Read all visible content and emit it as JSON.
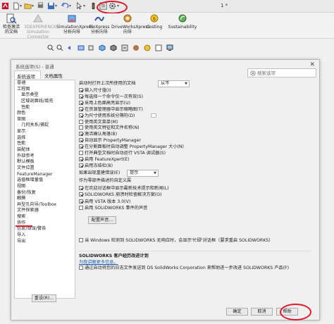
{
  "window": {
    "title": "1 *"
  },
  "toolbar_colors": {
    "accent": "#e0162b",
    "link": "#1a5fb4"
  },
  "ribbon": {
    "items": [
      {
        "label_1": "检查激活",
        "label_2": "的文档",
        "icon": "magnifier-doc-icon"
      },
      {
        "label_1": "3DEXPERIENCE",
        "label_2": "Simulation",
        "label_3": "Connector",
        "icon": "3dx-icon"
      },
      {
        "label_1": "SimulationXpress",
        "label_2": "分析向导",
        "icon": "simulation-icon"
      },
      {
        "label_1": "FloXpress",
        "label_2": "分析向导",
        "icon": "floxpress-icon"
      },
      {
        "label_1": "DriveWorksXpress",
        "label_2": "向导",
        "icon": "driveworks-icon"
      },
      {
        "label_1": "Costing",
        "icon": "costing-icon"
      },
      {
        "label_1": "Sustainability",
        "icon": "sustainability-icon"
      }
    ]
  },
  "dialog": {
    "title": "系统选项(S) - 普通",
    "tabs": [
      "系统选项(S)",
      "文档属性(D)"
    ],
    "search_placeholder": "搜索选项",
    "tree": [
      {
        "label": "普通",
        "level": 0
      },
      {
        "label": "工程图",
        "level": 0
      },
      {
        "label": "显示类型",
        "level": 1
      },
      {
        "label": "区域剖面线/填充",
        "level": 1
      },
      {
        "label": "性能",
        "level": 1
      },
      {
        "label": "颜色",
        "level": 0
      },
      {
        "label": "草图",
        "level": 0
      },
      {
        "label": "几何关系/捕捉",
        "level": 1
      },
      {
        "label": "显示",
        "level": 0
      },
      {
        "label": "选择",
        "level": 0
      },
      {
        "label": "性能",
        "level": 0
      },
      {
        "label": "装配体",
        "level": 0
      },
      {
        "label": "外部参考",
        "level": 0
      },
      {
        "label": "默认模板",
        "level": 0
      },
      {
        "label": "文件位置",
        "level": 0
      },
      {
        "label": "FeatureManager",
        "level": 0
      },
      {
        "label": "选值框增量值",
        "level": 0
      },
      {
        "label": "视图",
        "level": 0
      },
      {
        "label": "备份/恢复",
        "level": 0
      },
      {
        "label": "触摸",
        "level": 0
      },
      {
        "label": "异型孔向导/Toolbox",
        "level": 0
      },
      {
        "label": "文件探索器",
        "level": 0
      },
      {
        "label": "搜索",
        "level": 0
      },
      {
        "label": "协作",
        "level": 0
      },
      {
        "label": "信息/错误/警告",
        "level": 0
      },
      {
        "label": "导入",
        "level": 0
      },
      {
        "label": "导出",
        "level": 0
      }
    ],
    "reset_label": "重设(R)...",
    "general": {
      "open_last_label": "启动时打开上次所使用的文档",
      "open_last_value": "从不",
      "checks": [
        {
          "label": "输入尺寸值(I)",
          "checked": true
        },
        {
          "label": "每选择一个命令仅一次有效(S)",
          "checked": true
        },
        {
          "label": "采用上色面高亮显示(U)",
          "checked": true
        },
        {
          "label": "在资源管理器中显示缩略图(T)",
          "checked": true
        },
        {
          "label": "为尺寸使用系统分隔符(D)",
          "checked": true
        },
        {
          "label": "使用英文菜单(M)",
          "checked": false
        },
        {
          "label": "使用英文特征和文件名称(N)",
          "checked": false
        },
        {
          "label": "激活确认角落(B)",
          "checked": true
        },
        {
          "label": "自动显示 PropertyManager",
          "checked": true
        },
        {
          "label": "在分割面板时自动调整 PropertyManager 大小(N)",
          "checked": true
        },
        {
          "label": "打开典型文档时自动运行 VSTA 调试器(S)",
          "checked": false
        },
        {
          "label": "启用 FeatureXpert(E)",
          "checked": true
        },
        {
          "label": "启用冻结栏(B)",
          "checked": true
        }
      ],
      "rebuild_error_label": "如果出现重建错误(E)",
      "rebuild_error_value": "提示",
      "custom_props_heading": "作为零部件描述的自定义属",
      "checks2": [
        {
          "label": "在欢迎对话框中显示最新技术提示和新闻(L)",
          "checked": true
        },
        {
          "label": "SOLIDWORKS 崩溃时检查解决方案(O)",
          "checked": true
        },
        {
          "label": "启用 VSTA 版本 3.0(V)",
          "checked": true
        },
        {
          "label": "启用 SOLIDWORKS 事件的声音",
          "checked": false
        }
      ],
      "config_sound_label": "配置声音...",
      "windows_detect_label": "当 Windows 检测到 SOLIDWORKS 无响应时，会显示'忙碌'对话框（要求重启 SOLIDWORKS）",
      "windows_detect_checked": false,
      "ceip_heading": "SOLIDWORKS 客户经历改进计划",
      "ceip_link": "为我讲解更多信息。",
      "ceip_check_label": "通过自动将您的日志文件发送到 DS SolidWorks Corporation 来帮助进一步改进 SOLIDWORKS 产品(F)",
      "ceip_checked": false
    },
    "buttons": {
      "ok": "确定",
      "cancel": "取消",
      "help": "帮助"
    }
  }
}
